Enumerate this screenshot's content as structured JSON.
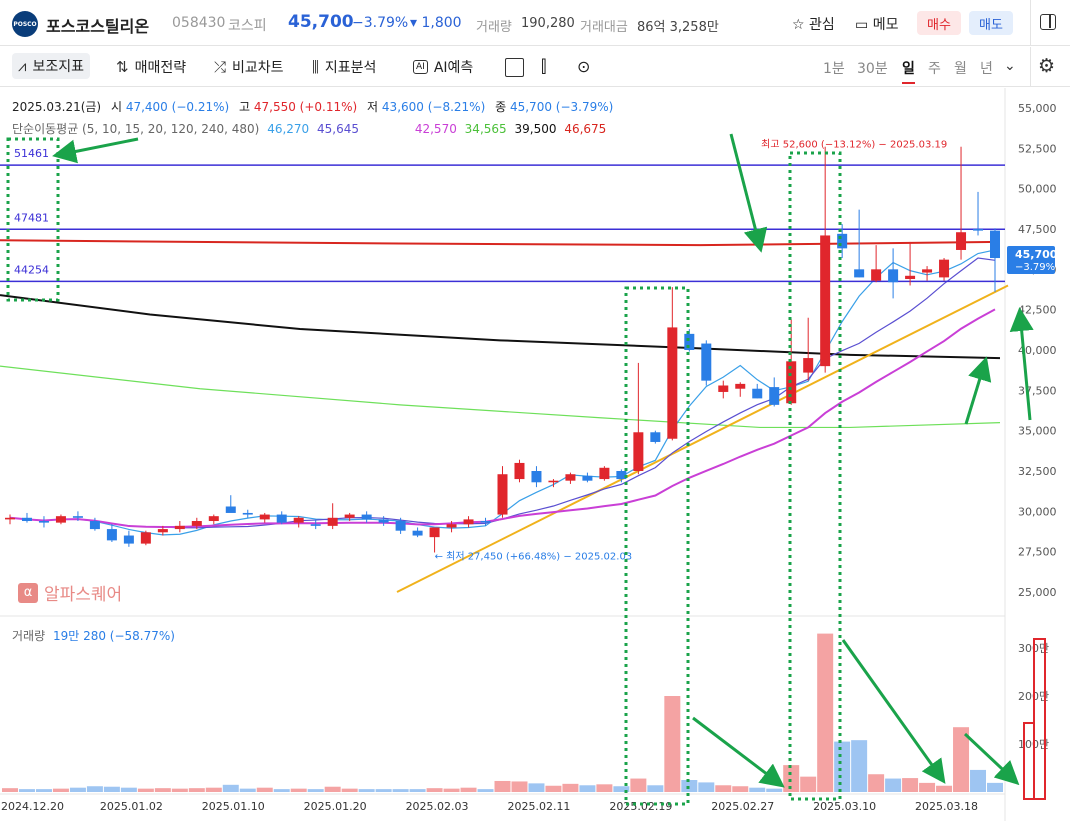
{
  "header": {
    "logo_text": "POSCO",
    "name": "포스코스틸리온",
    "code": "058430",
    "market": "코스피",
    "price": "45,700",
    "change_pct": "−3.79%",
    "change_abs": "▾ 1,800",
    "volume_label": "거래량",
    "volume": "190,280",
    "amount_label": "거래대금",
    "amount": "86억 3,258만",
    "watch_label": "관심",
    "memo_label": "메모",
    "buy_label": "매수",
    "sell_label": "매도"
  },
  "toolbar": {
    "items": [
      "보조지표",
      "매매전략",
      "비교차트",
      "지표분석",
      "AI예측"
    ],
    "periods": [
      "1분",
      "30분",
      "일",
      "주",
      "월",
      "년"
    ],
    "active_period": "일"
  },
  "legend": {
    "line1": {
      "date": "2025.03.21(금)",
      "open_label": "시",
      "open": "47,400 (−0.21%)",
      "high_label": "고",
      "high": "47,550 (+0.11%)",
      "low_label": "저",
      "low": "43,600 (−8.21%)",
      "close_label": "종",
      "close": "45,700 (−3.79%)"
    },
    "line2": {
      "label": "단순이동평균 (5, 10, 15, 20, 120, 240, 480)",
      "values": [
        "46,270",
        "45,645",
        "42,570",
        "34,565",
        "39,500",
        "46,675"
      ]
    },
    "volume_label": "거래량",
    "volume_value": "19만 280 (−58.77%)"
  },
  "annotations": {
    "hline_labels": [
      "51461",
      "47481",
      "44254"
    ],
    "max_label": "최고 52,600 (−13.12%) − 2025.03.19",
    "min_label": "← 최저 27,450 (+66.48%) − 2025.02.03",
    "watermark": "알파스퀘어",
    "price_tag": "45,700",
    "price_tag_pct": "−3.79%"
  },
  "axes": {
    "price_ticks": [
      "55,000",
      "52,500",
      "50,000",
      "47,500",
      "45,000",
      "42,500",
      "40,000",
      "37,500",
      "35,000",
      "32,500",
      "30,000",
      "27,500",
      "25,000"
    ],
    "volume_ticks": [
      "300만",
      "200만",
      "100만"
    ],
    "date_ticks": [
      "2024.12.20",
      "2025.01.02",
      "2025.01.10",
      "2025.01.20",
      "2025.02.03",
      "2025.02.11",
      "2025.02.19",
      "2025.02.27",
      "2025.03.10",
      "2025.03.18"
    ]
  },
  "colors": {
    "up": "#e0262c",
    "down": "#2a7ee6",
    "ma5": "#3aa0e8",
    "ma10": "#5a4fd1",
    "ma20": "#c93fd6",
    "ma120": "#111111",
    "ma240": "#6ee05a",
    "ma480": "#d8261f",
    "trend": "#f0b21b",
    "annotation": "#1aa34a"
  },
  "chart_data": {
    "type": "candlestick",
    "candles": [
      {
        "o": 29500,
        "h": 29800,
        "l": 29200,
        "c": 29600
      },
      {
        "o": 29600,
        "h": 29900,
        "l": 29300,
        "c": 29400
      },
      {
        "o": 29400,
        "h": 29700,
        "l": 29000,
        "c": 29300
      },
      {
        "o": 29300,
        "h": 29800,
        "l": 29200,
        "c": 29700
      },
      {
        "o": 29700,
        "h": 30000,
        "l": 29400,
        "c": 29600
      },
      {
        "o": 29400,
        "h": 29600,
        "l": 28800,
        "c": 28900
      },
      {
        "o": 28900,
        "h": 29200,
        "l": 28100,
        "c": 28200
      },
      {
        "o": 28500,
        "h": 28800,
        "l": 27800,
        "c": 28000
      },
      {
        "o": 28000,
        "h": 28800,
        "l": 27900,
        "c": 28700
      },
      {
        "o": 28700,
        "h": 29100,
        "l": 28500,
        "c": 28900
      },
      {
        "o": 28900,
        "h": 29400,
        "l": 28700,
        "c": 29100
      },
      {
        "o": 29100,
        "h": 29600,
        "l": 28900,
        "c": 29400
      },
      {
        "o": 29400,
        "h": 29800,
        "l": 29200,
        "c": 29700
      },
      {
        "o": 30300,
        "h": 31000,
        "l": 30000,
        "c": 29900
      },
      {
        "o": 29900,
        "h": 30100,
        "l": 29600,
        "c": 29800
      },
      {
        "o": 29500,
        "h": 29900,
        "l": 29300,
        "c": 29800
      },
      {
        "o": 29800,
        "h": 30000,
        "l": 29200,
        "c": 29300
      },
      {
        "o": 29300,
        "h": 29700,
        "l": 29000,
        "c": 29600
      },
      {
        "o": 29200,
        "h": 29500,
        "l": 28900,
        "c": 29100
      },
      {
        "o": 29100,
        "h": 30500,
        "l": 28900,
        "c": 29600
      },
      {
        "o": 29600,
        "h": 29900,
        "l": 29400,
        "c": 29800
      },
      {
        "o": 29800,
        "h": 30000,
        "l": 29300,
        "c": 29500
      },
      {
        "o": 29500,
        "h": 29700,
        "l": 29100,
        "c": 29300
      },
      {
        "o": 29400,
        "h": 29600,
        "l": 28600,
        "c": 28800
      },
      {
        "o": 28800,
        "h": 29000,
        "l": 28400,
        "c": 28500
      },
      {
        "o": 28400,
        "h": 28700,
        "l": 27450,
        "c": 29000
      },
      {
        "o": 29000,
        "h": 29400,
        "l": 28700,
        "c": 29200
      },
      {
        "o": 29200,
        "h": 29700,
        "l": 29000,
        "c": 29500
      },
      {
        "o": 29400,
        "h": 29600,
        "l": 29100,
        "c": 29300
      },
      {
        "o": 29800,
        "h": 32800,
        "l": 29600,
        "c": 32300
      },
      {
        "o": 32000,
        "h": 33200,
        "l": 31800,
        "c": 33000
      },
      {
        "o": 32500,
        "h": 32800,
        "l": 31500,
        "c": 31800
      },
      {
        "o": 31800,
        "h": 32000,
        "l": 31500,
        "c": 31900
      },
      {
        "o": 31900,
        "h": 32400,
        "l": 31700,
        "c": 32300
      },
      {
        "o": 32200,
        "h": 32400,
        "l": 31800,
        "c": 31900
      },
      {
        "o": 32000,
        "h": 32800,
        "l": 31900,
        "c": 32700
      },
      {
        "o": 32500,
        "h": 32600,
        "l": 31800,
        "c": 32000
      },
      {
        "o": 32500,
        "h": 39200,
        "l": 32300,
        "c": 34900
      },
      {
        "o": 34900,
        "h": 35000,
        "l": 34200,
        "c": 34300
      },
      {
        "o": 34500,
        "h": 43900,
        "l": 34400,
        "c": 41400
      },
      {
        "o": 41000,
        "h": 41300,
        "l": 39900,
        "c": 40000
      },
      {
        "o": 40400,
        "h": 40600,
        "l": 37800,
        "c": 38100
      },
      {
        "o": 37400,
        "h": 38100,
        "l": 37000,
        "c": 37800
      },
      {
        "o": 37600,
        "h": 38000,
        "l": 37100,
        "c": 37900
      },
      {
        "o": 37600,
        "h": 37900,
        "l": 37000,
        "c": 37000
      },
      {
        "o": 37700,
        "h": 38300,
        "l": 36500,
        "c": 36600
      },
      {
        "o": 36700,
        "h": 41900,
        "l": 36600,
        "c": 39300
      },
      {
        "o": 38600,
        "h": 42000,
        "l": 38100,
        "c": 39500
      },
      {
        "o": 39000,
        "h": 52600,
        "l": 38600,
        "c": 47100
      },
      {
        "o": 47200,
        "h": 47800,
        "l": 45700,
        "c": 46300
      },
      {
        "o": 45000,
        "h": 48700,
        "l": 44500,
        "c": 44500
      },
      {
        "o": 44300,
        "h": 46500,
        "l": 44200,
        "c": 45000
      },
      {
        "o": 45000,
        "h": 46300,
        "l": 43200,
        "c": 44200
      },
      {
        "o": 44400,
        "h": 46700,
        "l": 44000,
        "c": 44600
      },
      {
        "o": 44800,
        "h": 45200,
        "l": 44300,
        "c": 45000
      },
      {
        "o": 44500,
        "h": 45700,
        "l": 44300,
        "c": 45600
      },
      {
        "o": 46200,
        "h": 52600,
        "l": 45600,
        "c": 47300
      },
      {
        "o": 47500,
        "h": 49800,
        "l": 47100,
        "c": 47400
      },
      {
        "o": 47400,
        "h": 47550,
        "l": 43600,
        "c": 45700
      }
    ],
    "volume": [
      80000,
      60000,
      60000,
      70000,
      90000,
      120000,
      110000,
      90000,
      70000,
      80000,
      70000,
      80000,
      90000,
      150000,
      70000,
      90000,
      60000,
      70000,
      60000,
      110000,
      70000,
      60000,
      60000,
      60000,
      60000,
      80000,
      70000,
      90000,
      60000,
      230000,
      220000,
      180000,
      130000,
      170000,
      140000,
      160000,
      120000,
      280000,
      140000,
      2000000,
      250000,
      200000,
      140000,
      120000,
      90000,
      70000,
      560000,
      320000,
      3300000,
      1050000,
      1080000,
      370000,
      280000,
      290000,
      190000,
      130000,
      1350000,
      460000,
      190280
    ],
    "hlines": [
      51461,
      47481,
      44254
    ],
    "ylim": [
      24000,
      56000
    ]
  }
}
